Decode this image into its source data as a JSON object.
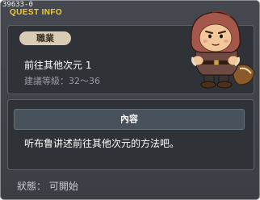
{
  "window": {
    "quest_id": "39633-0",
    "title": "QUEST INFO"
  },
  "job_section": {
    "badge_label": "職業",
    "quest_name": "前往其他次元 1",
    "level_label": "建議等級：32～36"
  },
  "content_section": {
    "header_label": "內容",
    "description": "听布鲁讲述前往其他次元的方法吧。"
  },
  "status": {
    "text": "狀態： 可開始"
  },
  "npc": {
    "icon": "hooded-npc-sprite"
  },
  "colors": {
    "title": "#f2cd2f",
    "window_bg": "#3f4247",
    "panel_bg": "#2f3237",
    "badge_bg": "#d9cbb4",
    "header_bg": "#48525c"
  }
}
